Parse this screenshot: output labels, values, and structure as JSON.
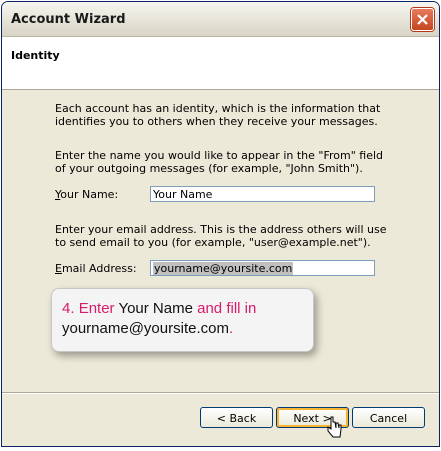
{
  "window": {
    "title": "Account Wizard"
  },
  "header": {
    "title": "Identity"
  },
  "content": {
    "intro": "Each account has an identity, which is the information that identifies you to others when they receive your messages.",
    "name_instructions": "Enter the name you would like to appear in the \"From\" field of your outgoing messages (for example, \"John Smith\").",
    "name_label_accel": "Y",
    "name_label_rest": "our Name:",
    "name_value": "Your Name",
    "email_instructions": "Enter your email address. This is the address others will use to send email to you (for example, \"user@example.net\").",
    "email_label_accel": "E",
    "email_label_rest": "mail Address:",
    "email_value": "yourname@yoursite.com"
  },
  "callout": {
    "step": "4.",
    "enter": "Enter",
    "name": "Your Name",
    "and_fill_in": "and fill in",
    "email": "yourname@yoursite.com",
    "period": "."
  },
  "buttons": {
    "back": "< Back",
    "next": "Next >",
    "cancel": "Cancel"
  }
}
